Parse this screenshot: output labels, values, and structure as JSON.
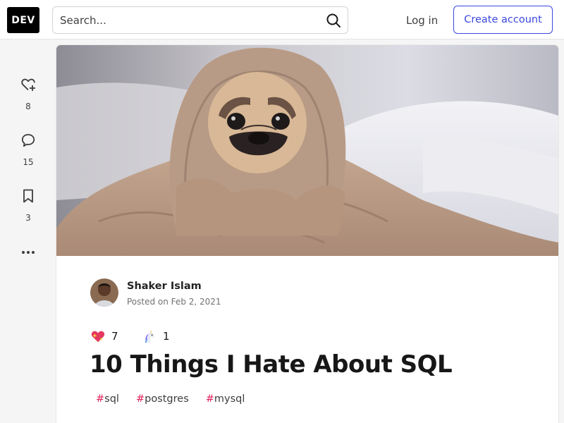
{
  "header": {
    "logo_text": "DEV",
    "search_placeholder": "Search...",
    "login_label": "Log in",
    "create_account_label": "Create account",
    "accent_color": "#3b49df"
  },
  "actions": {
    "reactions_count": "8",
    "comments_count": "15",
    "saves_count": "3",
    "icons": [
      "heart-plus-icon",
      "comment-icon",
      "bookmark-icon",
      "more-dots-icon"
    ]
  },
  "article": {
    "author_name": "Shaker Islam",
    "posted_label": "Posted on Feb 2, 2021",
    "reactions": [
      {
        "icon": "sparkle-heart-icon",
        "count": "7"
      },
      {
        "icon": "unicorn-icon",
        "count": "1"
      }
    ],
    "title": "10 Things I Hate About SQL",
    "tags": [
      {
        "hash": "#",
        "name": "sql",
        "color": "#e0245e"
      },
      {
        "hash": "#",
        "name": "postgres",
        "color": "#e0245e"
      },
      {
        "hash": "#",
        "name": "mysql",
        "color": "#e0245e"
      }
    ]
  }
}
